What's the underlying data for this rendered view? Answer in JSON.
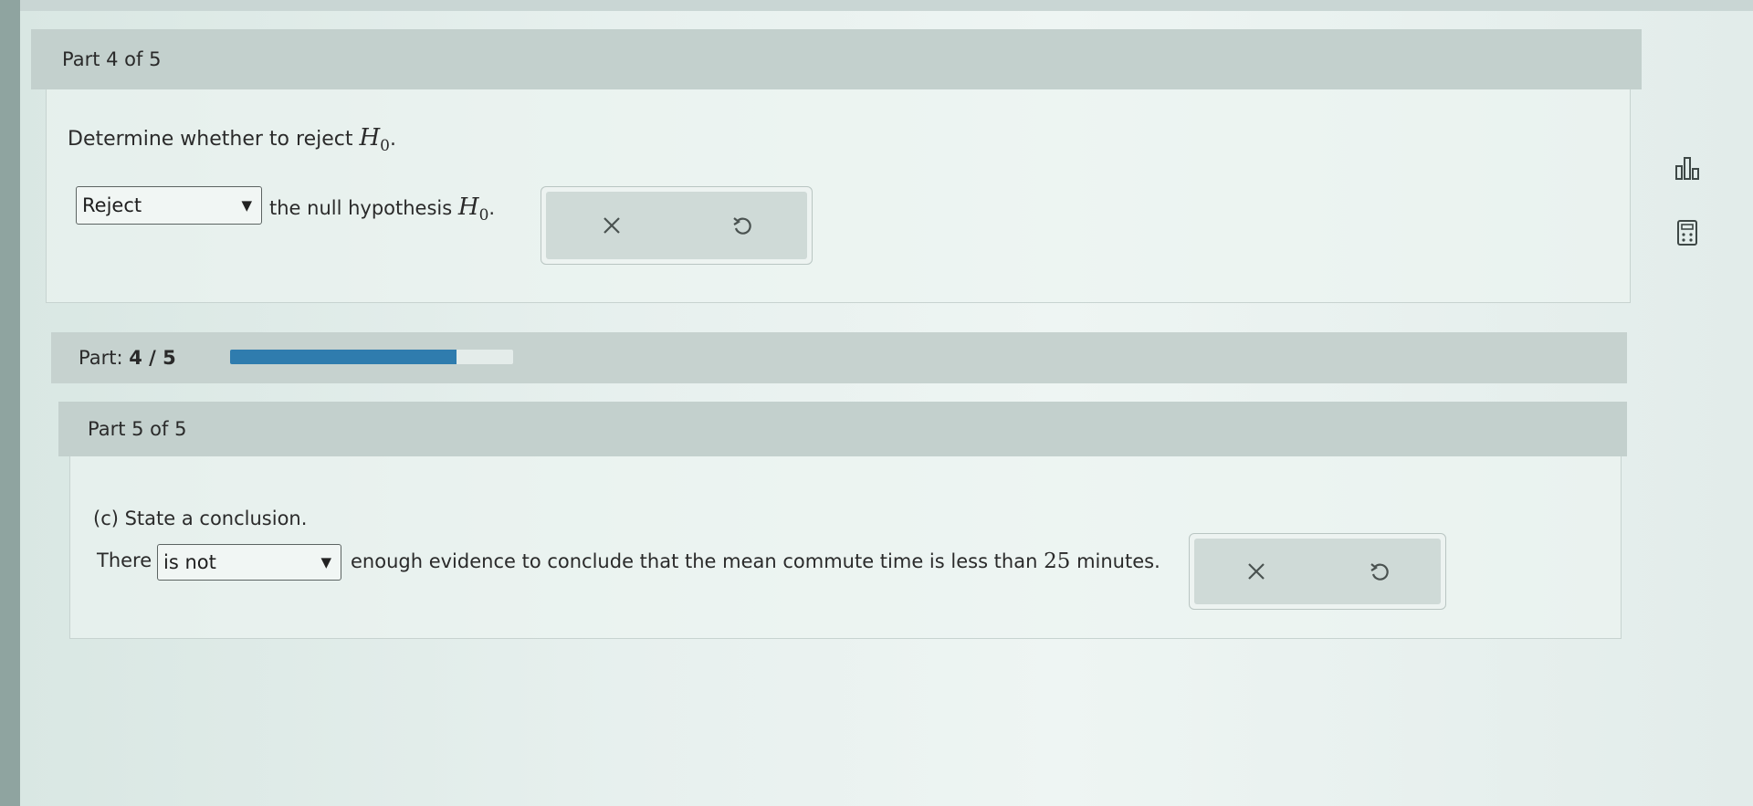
{
  "part4": {
    "header": "Part 4 of 5",
    "prompt_text": "Determine whether to reject",
    "symbol": "H",
    "subscript": "0",
    "period": ".",
    "select_value": "Reject",
    "after_select_text": "the null hypothesis"
  },
  "progress": {
    "label": "Part:",
    "value": "4 / 5",
    "fraction": 0.8
  },
  "part5": {
    "header": "Part 5 of 5",
    "prompt_text": "(c) State a conclusion.",
    "before_select_text": "There",
    "select_value": "is not",
    "after_select_text": "enough evidence to conclude that the mean commute time is less than",
    "number": "25",
    "unit_text": "minutes."
  },
  "icons": {
    "clear": "close-x-icon",
    "undo": "undo-icon",
    "stats": "bar-chart-icon",
    "calculator": "calculator-icon"
  },
  "colors": {
    "progress_fill": "#2f7cae",
    "header_bg": "#c3d0cd"
  }
}
